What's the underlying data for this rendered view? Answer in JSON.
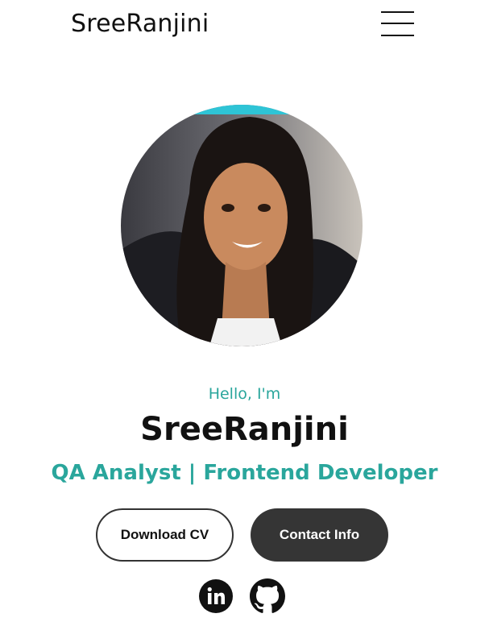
{
  "nav": {
    "logo": "SreeRanjini",
    "menu_icon": "hamburger-menu-icon"
  },
  "hero": {
    "greeting": "Hello, I'm",
    "name": "SreeRanjini",
    "role": "QA Analyst | Frontend Developer"
  },
  "buttons": {
    "download_cv": "Download CV",
    "contact_info": "Contact Info"
  },
  "social": [
    {
      "icon": "linkedin-icon",
      "label": "in"
    },
    {
      "icon": "github-icon"
    }
  ],
  "colors": {
    "accent": "#2aa69c",
    "dark_button": "#353535",
    "text": "#111111"
  }
}
